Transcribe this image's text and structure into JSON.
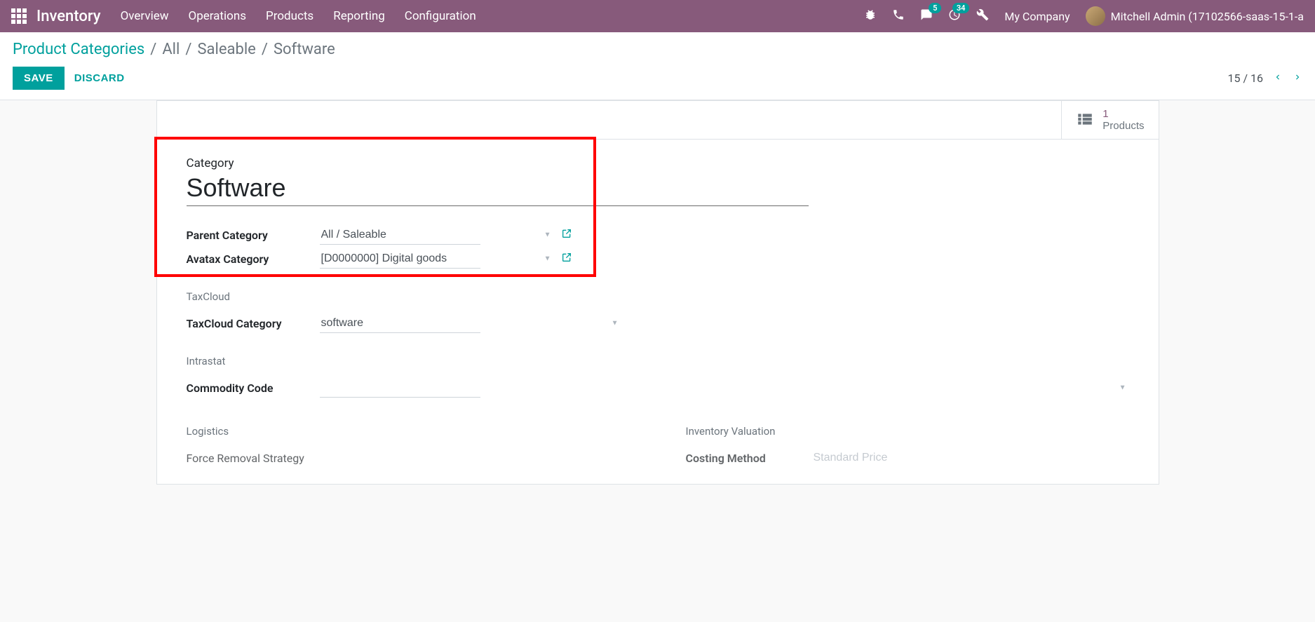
{
  "navbar": {
    "brand": "Inventory",
    "menu": [
      "Overview",
      "Operations",
      "Products",
      "Reporting",
      "Configuration"
    ],
    "msg_badge": "5",
    "activity_badge": "34",
    "company": "My Company",
    "user": "Mitchell Admin (17102566-saas-15-1-a"
  },
  "breadcrumb": {
    "root": "Product Categories",
    "path": [
      "All",
      "Saleable",
      "Software"
    ]
  },
  "buttons": {
    "save": "SAVE",
    "discard": "DISCARD"
  },
  "pager": {
    "current": "15",
    "total": "16"
  },
  "stat": {
    "value": "1",
    "label": "Products"
  },
  "form": {
    "category_label": "Category",
    "category_value": "Software",
    "parent_label": "Parent Category",
    "parent_value": "All / Saleable",
    "avatax_label": "Avatax Category",
    "avatax_value": "[D0000000] Digital goods",
    "taxcloud_section": "TaxCloud",
    "taxcloud_label": "TaxCloud Category",
    "taxcloud_value": "software",
    "intrastat_section": "Intrastat",
    "commodity_label": "Commodity Code",
    "commodity_value": "",
    "logistics_section": "Logistics",
    "removal_label": "Force Removal Strategy",
    "removal_value": "",
    "valuation_section": "Inventory Valuation",
    "costing_label": "Costing Method",
    "costing_value": "Standard Price"
  }
}
